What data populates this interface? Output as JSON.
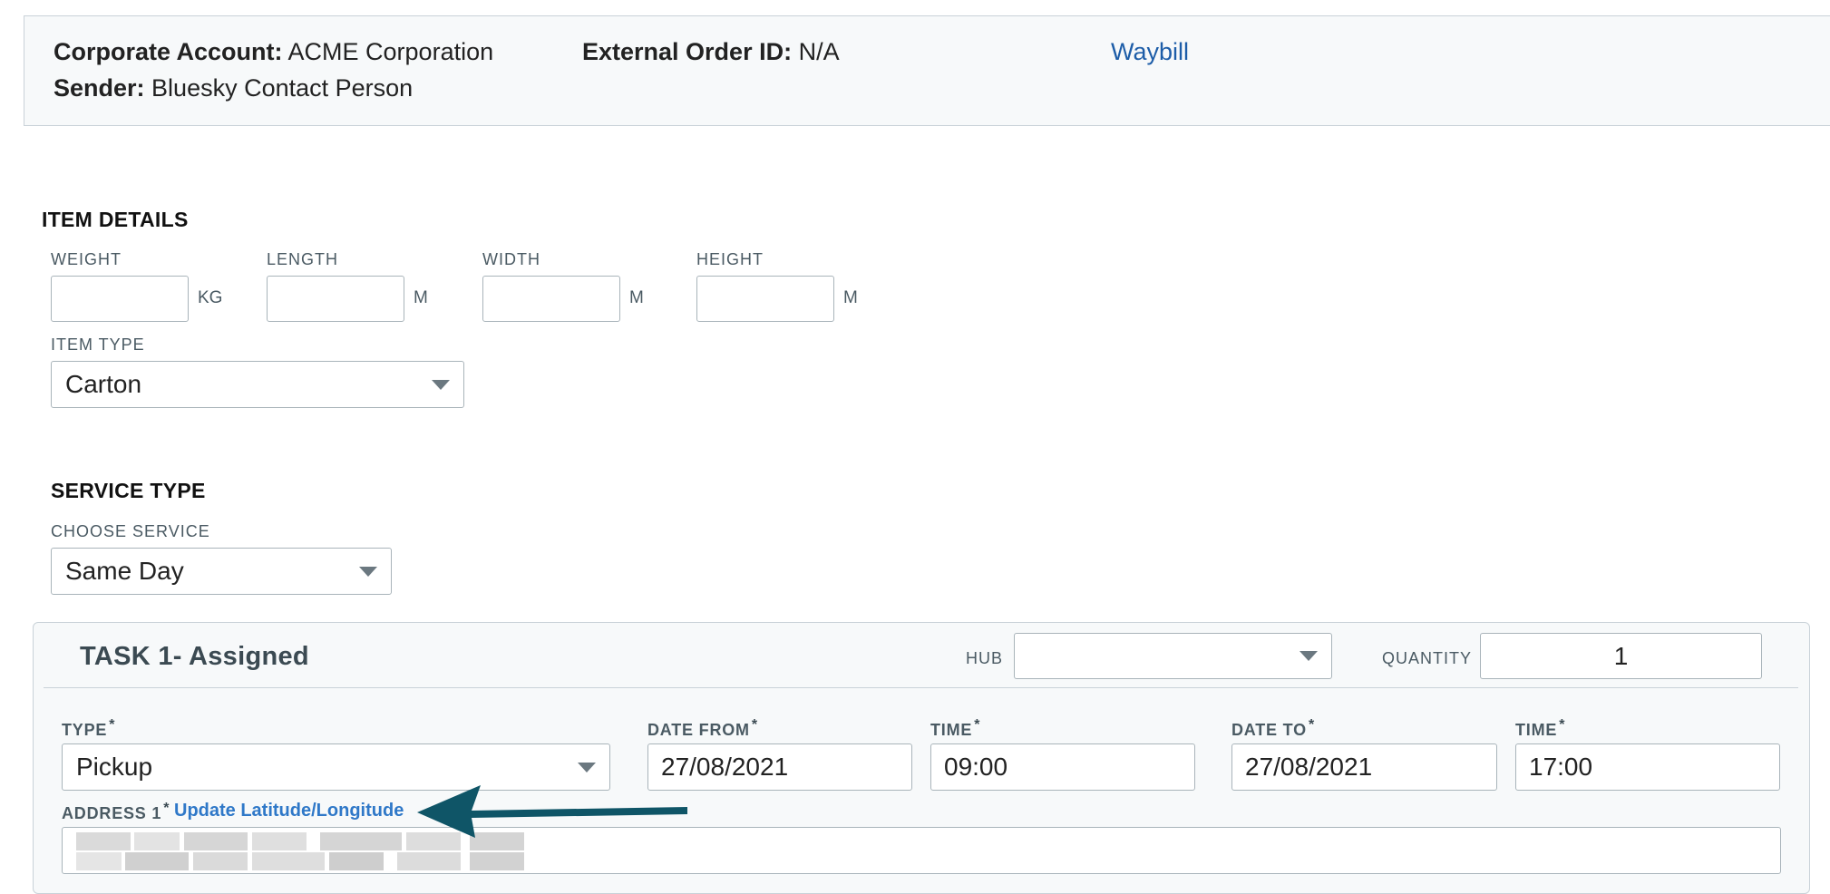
{
  "header": {
    "corporate_account_label": "Corporate Account:",
    "corporate_account_value": "ACME Corporation",
    "sender_label": "Sender:",
    "sender_value": "Bluesky Contact Person",
    "external_order_label": "External Order ID:",
    "external_order_value": "N/A",
    "waybill_link": "Waybill"
  },
  "item_details": {
    "title": "ITEM DETAILS",
    "weight_label": "WEIGHT",
    "weight_value": "",
    "weight_unit": "KG",
    "length_label": "LENGTH",
    "length_value": "",
    "length_unit": "M",
    "width_label": "WIDTH",
    "width_value": "",
    "width_unit": "M",
    "height_label": "HEIGHT",
    "height_value": "",
    "height_unit": "M",
    "item_type_label": "ITEM TYPE",
    "item_type_value": "Carton"
  },
  "service_type": {
    "title": "SERVICE TYPE",
    "choose_label": "CHOOSE SERVICE",
    "choose_value": "Same Day"
  },
  "task": {
    "title": "TASK 1- Assigned",
    "hub_label": "HUB",
    "hub_value": "",
    "quantity_label": "QUANTITY",
    "quantity_value": "1",
    "required_mark": "*",
    "type_label": "TYPE",
    "type_value": "Pickup",
    "date_from_label": "DATE FROM",
    "date_from_value": "27/08/2021",
    "time_from_label": "TIME",
    "time_from_value": "09:00",
    "date_to_label": "DATE TO",
    "date_to_value": "27/08/2021",
    "time_to_label": "TIME",
    "time_to_value": "17:00",
    "address_label": "ADDRESS 1",
    "update_link": "Update Latitude/Longitude"
  },
  "colors": {
    "arrow": "#0f5567",
    "link": "#1d5da8",
    "update_link": "#2f78c8"
  },
  "icons": {
    "dropdown": "chevron-down-icon",
    "annotation": "arrow-left-icon"
  }
}
